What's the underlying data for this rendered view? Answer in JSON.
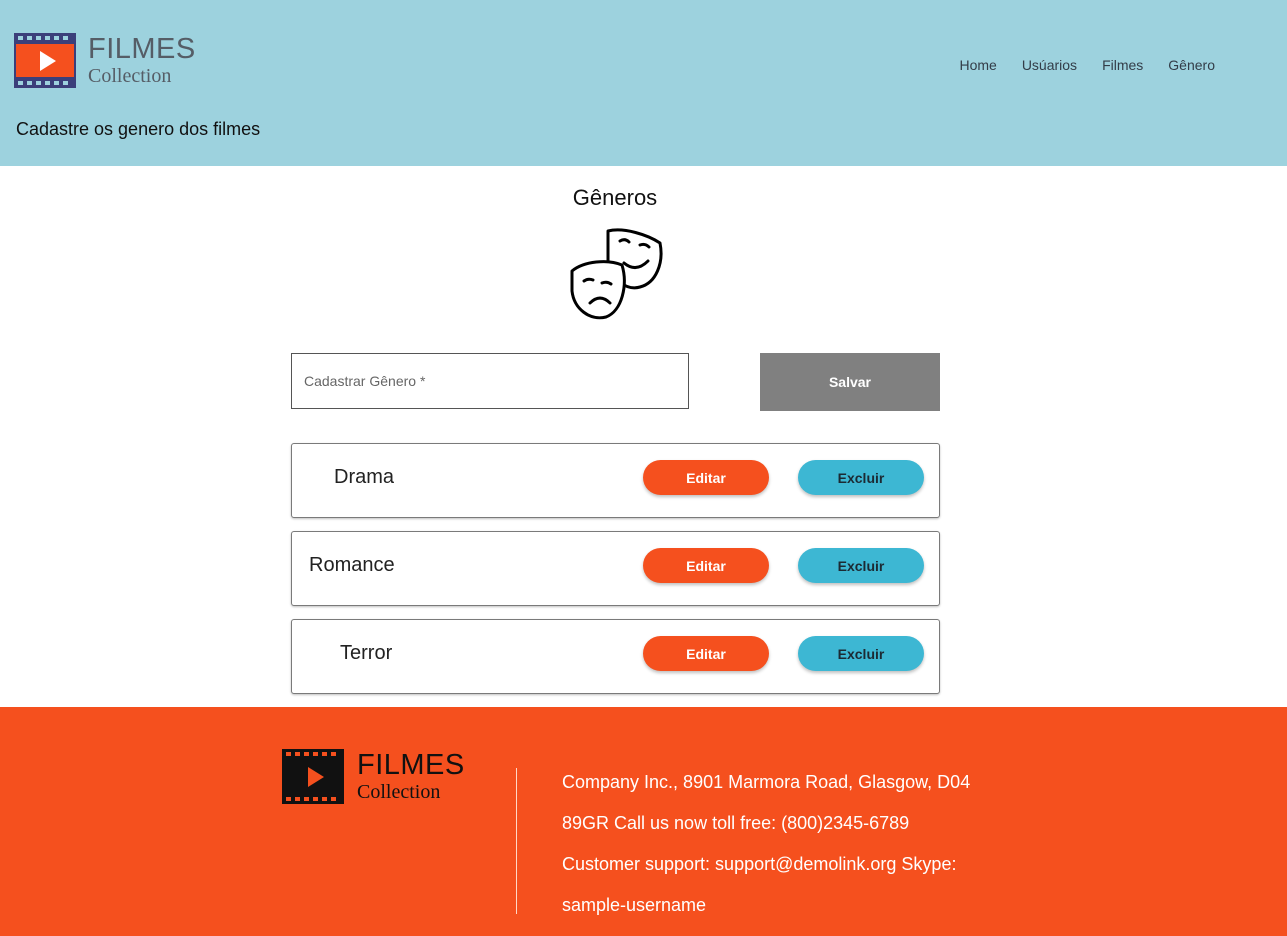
{
  "brand": {
    "title": "FILMES",
    "subtitle": "Collection"
  },
  "nav": {
    "items": [
      "Home",
      "Usúarios",
      "Filmes",
      "Gênero"
    ]
  },
  "header": {
    "subtitle": "Cadastre os genero dos filmes"
  },
  "main": {
    "title": "Gêneros",
    "input_placeholder": "Cadastrar Gênero *",
    "save_label": "Salvar",
    "genres": [
      {
        "name": "Drama",
        "edit_label": "Editar",
        "delete_label": "Excluir"
      },
      {
        "name": "Romance",
        "edit_label": "Editar",
        "delete_label": "Excluir"
      },
      {
        "name": "Terror",
        "edit_label": "Editar",
        "delete_label": "Excluir"
      }
    ]
  },
  "footer": {
    "lines": [
      "Company Inc., 8901 Marmora Road, Glasgow, D04",
      "89GR Call us now toll free: (800)2345-6789",
      "Customer support: support@demolink.org Skype:",
      "sample-username"
    ]
  },
  "colors": {
    "header_bg": "#9dd2de",
    "accent_orange": "#f5501e",
    "accent_blue": "#3db7d3",
    "save_gray": "#808080"
  },
  "icons": {
    "logo": "film-play-icon",
    "genre": "theater-masks-icon"
  }
}
